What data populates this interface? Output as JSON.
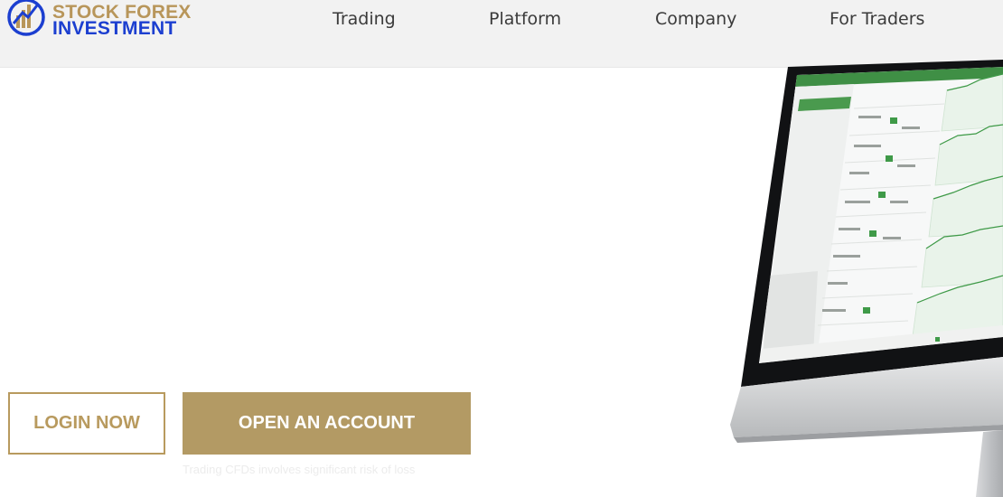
{
  "brand": {
    "line1": "STOCK FOREX",
    "line2": "INVESTMENT",
    "gold": "#b8965a",
    "blue": "#1c3fd0"
  },
  "nav": {
    "items": [
      {
        "label": "Trading"
      },
      {
        "label": "Platform"
      },
      {
        "label": "Company"
      },
      {
        "label": "For Traders"
      }
    ]
  },
  "hero": {
    "login_label": "LOGIN NOW",
    "open_account_label": "OPEN AN ACCOUNT",
    "risk_note": "Trading CFDs involves significant risk of loss",
    "accent": "#b39a64"
  },
  "icons": {
    "logo": "bar-chart-arrow-logo",
    "monitor": "desktop-monitor-trading-platform"
  }
}
